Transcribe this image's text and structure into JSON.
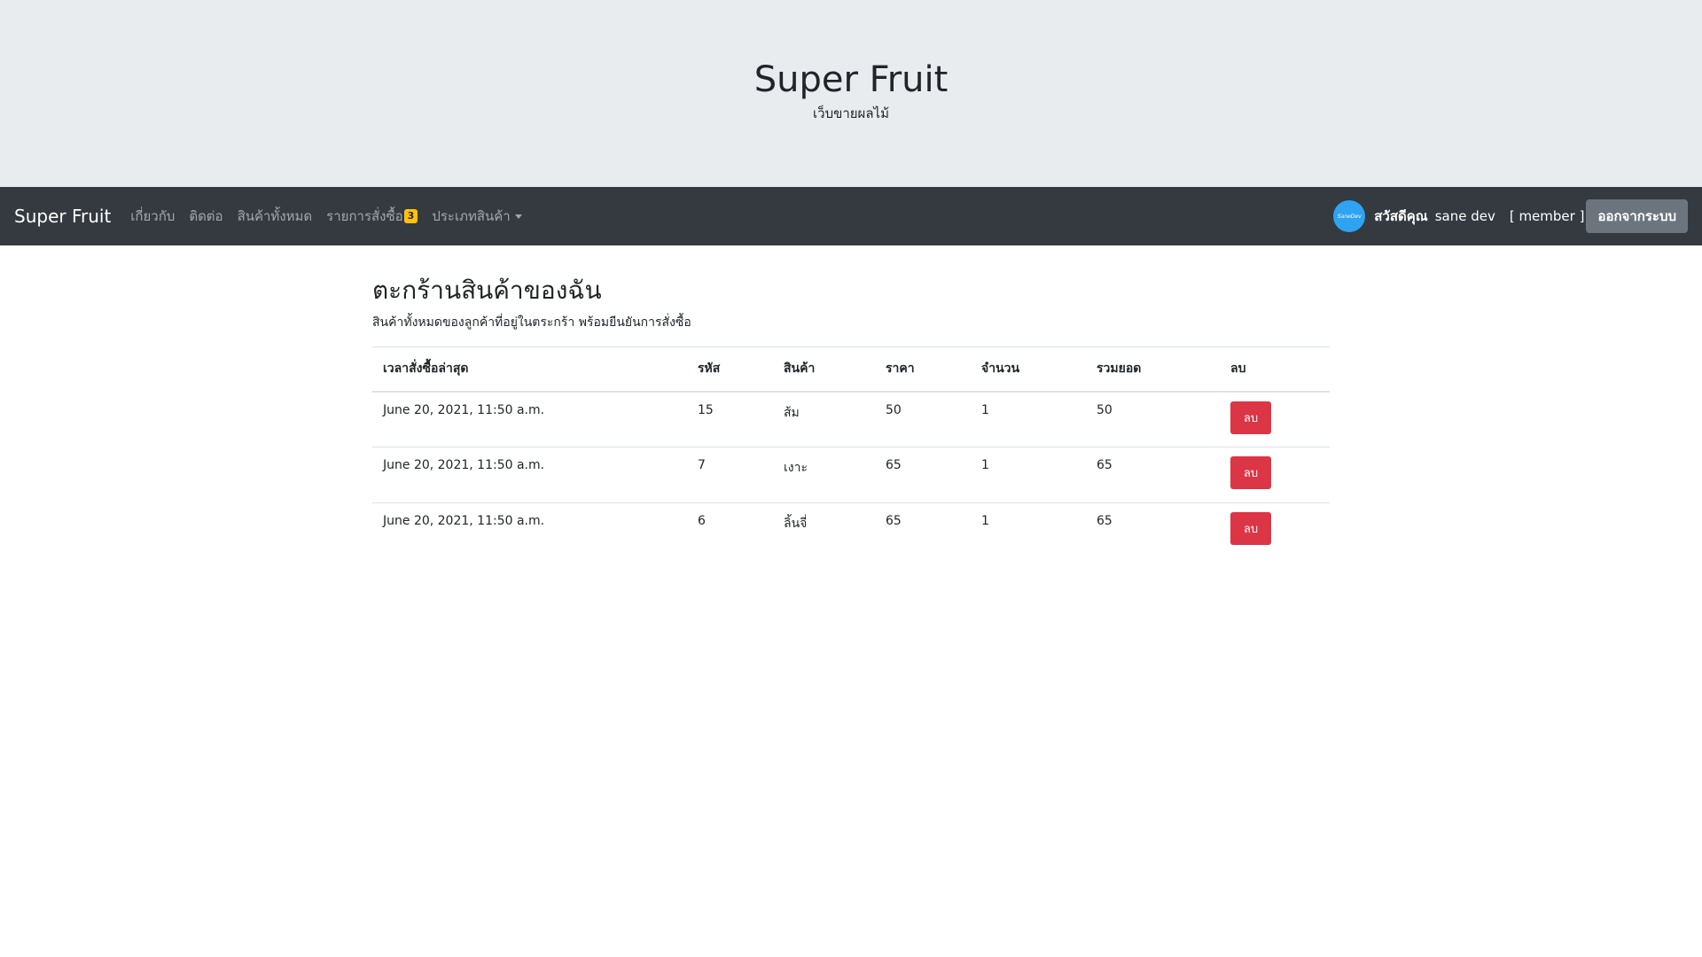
{
  "header": {
    "title": "Super Fruit",
    "subtitle": "เว็บขายผลไม้"
  },
  "navbar": {
    "brand": "Super Fruit",
    "links": {
      "about": "เกี่ยวกับ",
      "contact": "ติดต่อ",
      "all_products": "สินค้าทั้งหมด",
      "orders": "รายการสั่งซื้อ",
      "orders_badge": "3",
      "categories": "ประเภทสินค้า"
    },
    "user": {
      "avatar_text": "SaneDev",
      "greeting": "สวัสดีคุณ",
      "name": "sane dev",
      "role": "[ member ]",
      "logout_label": "ออกจากระบบ"
    },
    "colors": {
      "bg": "#343a40",
      "badge": "#ffc107",
      "logout": "#6c757d"
    }
  },
  "cart": {
    "title": "ตะกร้านสินค้าของฉัน",
    "description": "สินค้าทั้งหมดของลูกค้าที่อยู่ในตระกร้า พร้อมยืนยันการสั่งซื้อ",
    "columns": {
      "time": "เวลาสั่งซื้อล่าสุด",
      "code": "รหัส",
      "product": "สินค้า",
      "price": "ราคา",
      "qty": "จำนวน",
      "total": "รวมยอด",
      "delete": "ลบ"
    },
    "rows": [
      {
        "time": "June 20, 2021, 11:50 a.m.",
        "code": "15",
        "product": "ส้ม",
        "price": "50",
        "qty": "1",
        "total": "50",
        "delete_label": "ลบ"
      },
      {
        "time": "June 20, 2021, 11:50 a.m.",
        "code": "7",
        "product": "เงาะ",
        "price": "65",
        "qty": "1",
        "total": "65",
        "delete_label": "ลบ"
      },
      {
        "time": "June 20, 2021, 11:50 a.m.",
        "code": "6",
        "product": "ลิ้นจี่",
        "price": "65",
        "qty": "1",
        "total": "65",
        "delete_label": "ลบ"
      }
    ],
    "colors": {
      "delete_button": "#dc3545"
    }
  }
}
